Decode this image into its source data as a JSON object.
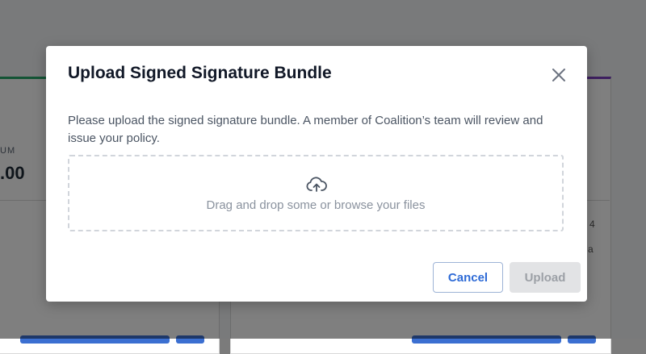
{
  "background": {
    "left_card": {
      "label": "UM",
      "value": ".00"
    },
    "right_card": {
      "snippet_a": "4",
      "snippet_b": "a"
    }
  },
  "modal": {
    "title": "Upload Signed Signature Bundle",
    "close_icon": "close-icon",
    "description": "Please upload the signed signature bundle. A member of Coalition’s team will review and issue your policy.",
    "dropzone": {
      "icon": "cloud-upload-icon",
      "text": "Drag and drop some or browse your files"
    },
    "buttons": {
      "cancel": "Cancel",
      "upload": "Upload"
    }
  },
  "colors": {
    "primary": "#2d6ad6",
    "overlay": "rgba(0,0,0,0.5)",
    "disabled_bg": "#e2e3e5"
  }
}
